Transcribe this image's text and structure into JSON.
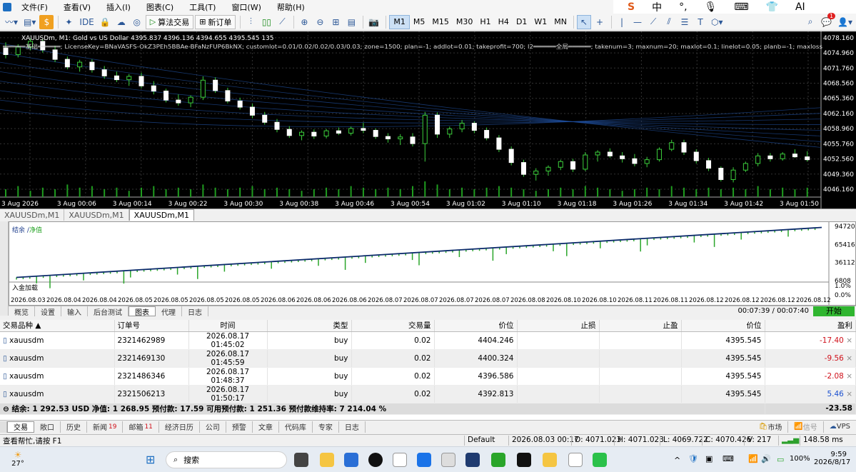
{
  "menu": {
    "file": "文件(F)",
    "view": "查看(V)",
    "insert": "插入(I)",
    "charts": "图表(C)",
    "tools": "工具(T)",
    "window": "窗口(W)",
    "help": "帮助(H)"
  },
  "sysmini": {
    "a": "中",
    "b": "AI"
  },
  "toolbar": {
    "ide": "IDE",
    "algo": "算法交易",
    "neworder": "新订单",
    "timeframes": [
      "M1",
      "M5",
      "M15",
      "M30",
      "H1",
      "H4",
      "D1",
      "W1",
      "MN"
    ],
    "selected_tf": "M1",
    "notif_count": "1"
  },
  "chart": {
    "header": "XAUUSDm, M1:  Gold vs US Dollar  4395.837 4396.136 4394.655 4395.545  135",
    "ea_text": "══════基础══════; LicenseKey=BNaVASFS-OkZ3PEh5BBAe-BFaNzFUP6BkNX; customlot=0.01/0.02/0.02/0.03/0.03; zone=1500; plan=-1; addlot=0.01; takeprofit=700; l2══════全局══════; takenum=3; maxnum=20; maxlot=0.1; linelot=0.05; planb=-1; maxloss",
    "price_labels": [
      "4078.160",
      "4074.960",
      "4071.760",
      "4068.560",
      "4065.360",
      "4062.160",
      "4058.960",
      "4055.760",
      "4052.560",
      "4049.360",
      "4046.160"
    ],
    "time_labels": [
      "3 Aug 2026",
      "3 Aug 00:06",
      "3 Aug 00:14",
      "3 Aug 00:22",
      "3 Aug 00:30",
      "3 Aug 00:38",
      "3 Aug 00:46",
      "3 Aug 00:54",
      "3 Aug 01:02",
      "3 Aug 01:10",
      "3 Aug 01:18",
      "3 Aug 01:26",
      "3 Aug 01:34",
      "3 Aug 01:42",
      "3 Aug 01:50"
    ],
    "ohlc": [
      [
        4076.0,
        4077.2,
        4073.8,
        4074.6
      ],
      [
        4074.6,
        4076.8,
        4074.0,
        4076.2
      ],
      [
        4076.2,
        4078.0,
        4075.5,
        4077.4
      ],
      [
        4077.4,
        4077.9,
        4075.0,
        4075.6
      ],
      [
        4075.6,
        4076.5,
        4073.0,
        4073.6
      ],
      [
        4073.6,
        4074.2,
        4071.5,
        4072.0
      ],
      [
        4072.0,
        4073.5,
        4071.0,
        4073.0
      ],
      [
        4073.0,
        4073.6,
        4070.8,
        4071.4
      ],
      [
        4071.4,
        4072.2,
        4069.5,
        4070.1
      ],
      [
        4070.1,
        4071.0,
        4068.8,
        4069.3
      ],
      [
        4069.3,
        4070.5,
        4068.0,
        4070.0
      ],
      [
        4070.0,
        4070.8,
        4067.5,
        4068.0
      ],
      [
        4068.0,
        4069.0,
        4066.2,
        4066.9
      ],
      [
        4066.9,
        4067.4,
        4064.5,
        4065.0
      ],
      [
        4065.0,
        4066.2,
        4063.8,
        4064.4
      ],
      [
        4064.4,
        4066.0,
        4063.5,
        4065.6
      ],
      [
        4065.6,
        4070.0,
        4065.0,
        4069.2
      ],
      [
        4069.2,
        4069.8,
        4066.5,
        4067.0
      ],
      [
        4067.0,
        4067.6,
        4064.3,
        4064.8
      ],
      [
        4064.8,
        4065.5,
        4063.0,
        4063.5
      ],
      [
        4063.5,
        4064.2,
        4061.2,
        4061.8
      ],
      [
        4061.8,
        4062.5,
        4059.8,
        4060.3
      ],
      [
        4060.3,
        4061.0,
        4058.2,
        4058.8
      ],
      [
        4058.8,
        4059.5,
        4057.0,
        4057.5
      ],
      [
        4057.5,
        4058.6,
        4056.5,
        4058.2
      ],
      [
        4058.2,
        4058.8,
        4056.8,
        4057.4
      ],
      [
        4057.4,
        4058.9,
        4056.9,
        4058.5
      ],
      [
        4058.5,
        4059.2,
        4057.6,
        4058.0
      ],
      [
        4058.0,
        4059.4,
        4057.5,
        4059.0
      ],
      [
        4059.0,
        4060.2,
        4058.0,
        4058.6
      ],
      [
        4058.6,
        4059.0,
        4056.8,
        4057.3
      ],
      [
        4057.3,
        4058.0,
        4056.0,
        4056.8
      ],
      [
        4056.8,
        4057.8,
        4055.5,
        4057.2
      ],
      [
        4057.2,
        4058.0,
        4055.2,
        4055.8
      ],
      [
        4055.8,
        4062.5,
        4052.0,
        4061.8
      ],
      [
        4061.8,
        4062.4,
        4057.0,
        4057.8
      ],
      [
        4057.8,
        4059.4,
        4057.0,
        4058.9
      ],
      [
        4058.9,
        4060.8,
        4058.2,
        4060.1
      ],
      [
        4060.1,
        4060.5,
        4058.0,
        4058.6
      ],
      [
        4058.6,
        4059.2,
        4056.5,
        4057.0
      ],
      [
        4057.0,
        4057.6,
        4054.0,
        4054.6
      ],
      [
        4054.6,
        4055.2,
        4051.2,
        4051.8
      ],
      [
        4051.8,
        4052.4,
        4048.8,
        4049.3
      ],
      [
        4049.3,
        4050.6,
        4048.0,
        4050.0
      ],
      [
        4050.0,
        4051.2,
        4049.0,
        4050.8
      ],
      [
        4050.8,
        4052.4,
        4050.2,
        4052.0
      ],
      [
        4052.0,
        4052.6,
        4049.8,
        4050.4
      ],
      [
        4050.4,
        4054.0,
        4050.0,
        4053.4
      ],
      [
        4053.4,
        4054.4,
        4052.0,
        4054.0
      ],
      [
        4054.0,
        4054.8,
        4052.8,
        4053.2
      ],
      [
        4053.2,
        4054.0,
        4051.8,
        4052.6
      ],
      [
        4052.6,
        4053.6,
        4051.0,
        4051.6
      ],
      [
        4051.6,
        4053.0,
        4050.8,
        4052.4
      ],
      [
        4052.4,
        4055.0,
        4052.0,
        4054.6
      ],
      [
        4054.6,
        4056.6,
        4054.2,
        4056.0
      ],
      [
        4056.0,
        4056.6,
        4053.4,
        4054.0
      ],
      [
        4054.0,
        4054.6,
        4051.6,
        4052.2
      ],
      [
        4052.2,
        4052.8,
        4050.0,
        4050.6
      ],
      [
        4050.6,
        4051.0,
        4047.8,
        4048.2
      ],
      [
        4048.2,
        4050.8,
        4047.6,
        4050.2
      ],
      [
        4050.2,
        4052.0,
        4049.8,
        4051.6
      ],
      [
        4051.6,
        4053.8,
        4051.0,
        4053.2
      ],
      [
        4053.2,
        4053.8,
        4052.0,
        4052.6
      ],
      [
        4052.6,
        4054.0,
        4052.2,
        4053.6
      ],
      [
        4053.6,
        4054.6,
        4052.8,
        4053.0
      ],
      [
        4053.0,
        4054.2,
        4052.0,
        4052.4
      ]
    ],
    "volumes": [
      0.5,
      0.7,
      0.4,
      0.6,
      0.5,
      0.8,
      0.6,
      0.7,
      0.5,
      0.6,
      0.4,
      0.6,
      0.7,
      0.5,
      0.6,
      0.5,
      0.8,
      0.6,
      0.5,
      0.6,
      0.7,
      0.5,
      0.6,
      0.5,
      0.4,
      0.5,
      0.6,
      0.5,
      0.7,
      0.6,
      0.5,
      0.6,
      0.5,
      0.7,
      1.0,
      0.8,
      0.5,
      0.6,
      0.5,
      0.6,
      0.7,
      0.6,
      0.5,
      0.4,
      0.5,
      0.6,
      0.5,
      0.7,
      0.6,
      0.5,
      0.4,
      0.5,
      0.6,
      0.5,
      0.7,
      0.6,
      0.5,
      0.6,
      0.5,
      0.6,
      0.5,
      0.7,
      0.5,
      0.6,
      0.5,
      0.6
    ],
    "price_range": [
      4044.5,
      4079.5
    ]
  },
  "chart_tabs": [
    "XAUUSDm,M1",
    "XAUUSDm,M1",
    "XAUUSDm,M1"
  ],
  "balance_chart": {
    "legend_balance": "结余",
    "legend_equity": "净值",
    "deposit_label": "入金加载",
    "y_labels": [
      "94720",
      "65416",
      "36112",
      "6808"
    ],
    "pct_labels": [
      "1.0%",
      "0.0%"
    ],
    "date_labels": [
      "2026.08.03",
      "2026.08.04",
      "2026.08.04",
      "2026.08.05",
      "2026.08.05",
      "2026.08.05",
      "2026.08.05",
      "2026.08.06",
      "2026.08.06",
      "2026.08.06",
      "2026.08.07",
      "2026.08.07",
      "2026.08.07",
      "2026.08.07",
      "2026.08.08",
      "2026.08.10",
      "2026.08.10",
      "2026.08.11",
      "2026.08.11",
      "2026.08.12",
      "2026.08.12",
      "2026.08.12",
      "2026.08.12"
    ],
    "range": [
      6808,
      94720
    ],
    "start": 12000,
    "end": 93000
  },
  "tester_tabs": {
    "items": [
      "概览",
      "设置",
      "输入",
      "后台测试",
      "图表",
      "代理",
      "日志"
    ],
    "active": "图表",
    "timer": "00:07:39 / 00:07:40",
    "start": "开始"
  },
  "trade": {
    "headers": {
      "symbol": "交易品种",
      "ticket": "订单号",
      "time": "时间",
      "type": "类型",
      "volume": "交易量",
      "price": "价位",
      "sl": "止损",
      "tp": "止盈",
      "cur": "价位",
      "profit": "盈利"
    },
    "rows": [
      {
        "symbol": "xauusdm",
        "ticket": "2321462989",
        "time": "2026.08.17 01:45:02",
        "type": "buy",
        "volume": "0.02",
        "price": "4404.246",
        "sl": "",
        "tp": "",
        "cur": "4395.545",
        "profit": "-17.40"
      },
      {
        "symbol": "xauusdm",
        "ticket": "2321469130",
        "time": "2026.08.17 01:45:59",
        "type": "buy",
        "volume": "0.02",
        "price": "4400.324",
        "sl": "",
        "tp": "",
        "cur": "4395.545",
        "profit": "-9.56"
      },
      {
        "symbol": "xauusdm",
        "ticket": "2321486346",
        "time": "2026.08.17 01:48:37",
        "type": "buy",
        "volume": "0.02",
        "price": "4396.586",
        "sl": "",
        "tp": "",
        "cur": "4395.545",
        "profit": "-2.08"
      },
      {
        "symbol": "xauusdm",
        "ticket": "2321506213",
        "time": "2026.08.17 01:50:17",
        "type": "buy",
        "volume": "0.02",
        "price": "4392.813",
        "sl": "",
        "tp": "",
        "cur": "4395.545",
        "profit": "5.46"
      }
    ],
    "summary": "结余: 1 292.53 USD  净值: 1 268.95  预付款: 17.59  可用预付款: 1 251.36  预付款维持率: 7 214.04 %",
    "total": "-23.58"
  },
  "bottom_tabs": {
    "items": [
      "交易",
      "敞口",
      "历史",
      "新闻",
      "邮箱",
      "经济日历",
      "公司",
      "预警",
      "文章",
      "代码库",
      "专家",
      "日志"
    ],
    "news_badge": "19",
    "mail_badge": "11",
    "market": "市场",
    "signals": "信号",
    "vps": "VPS"
  },
  "status": {
    "help": "查看帮忙,请按 F1",
    "profile": "Default",
    "time": "2026.08.03 00:17",
    "open": "O: 4071.023",
    "high": "H: 4071.023",
    "low": "L: 4069.722",
    "close": "C: 4070.426",
    "vol": "V: 217",
    "ping": "148.58 ms"
  },
  "taskbar": {
    "temp": "27°",
    "search": "搜索",
    "battery": "100%",
    "clock_time": "9:59",
    "clock_date": "2026/8/17"
  }
}
